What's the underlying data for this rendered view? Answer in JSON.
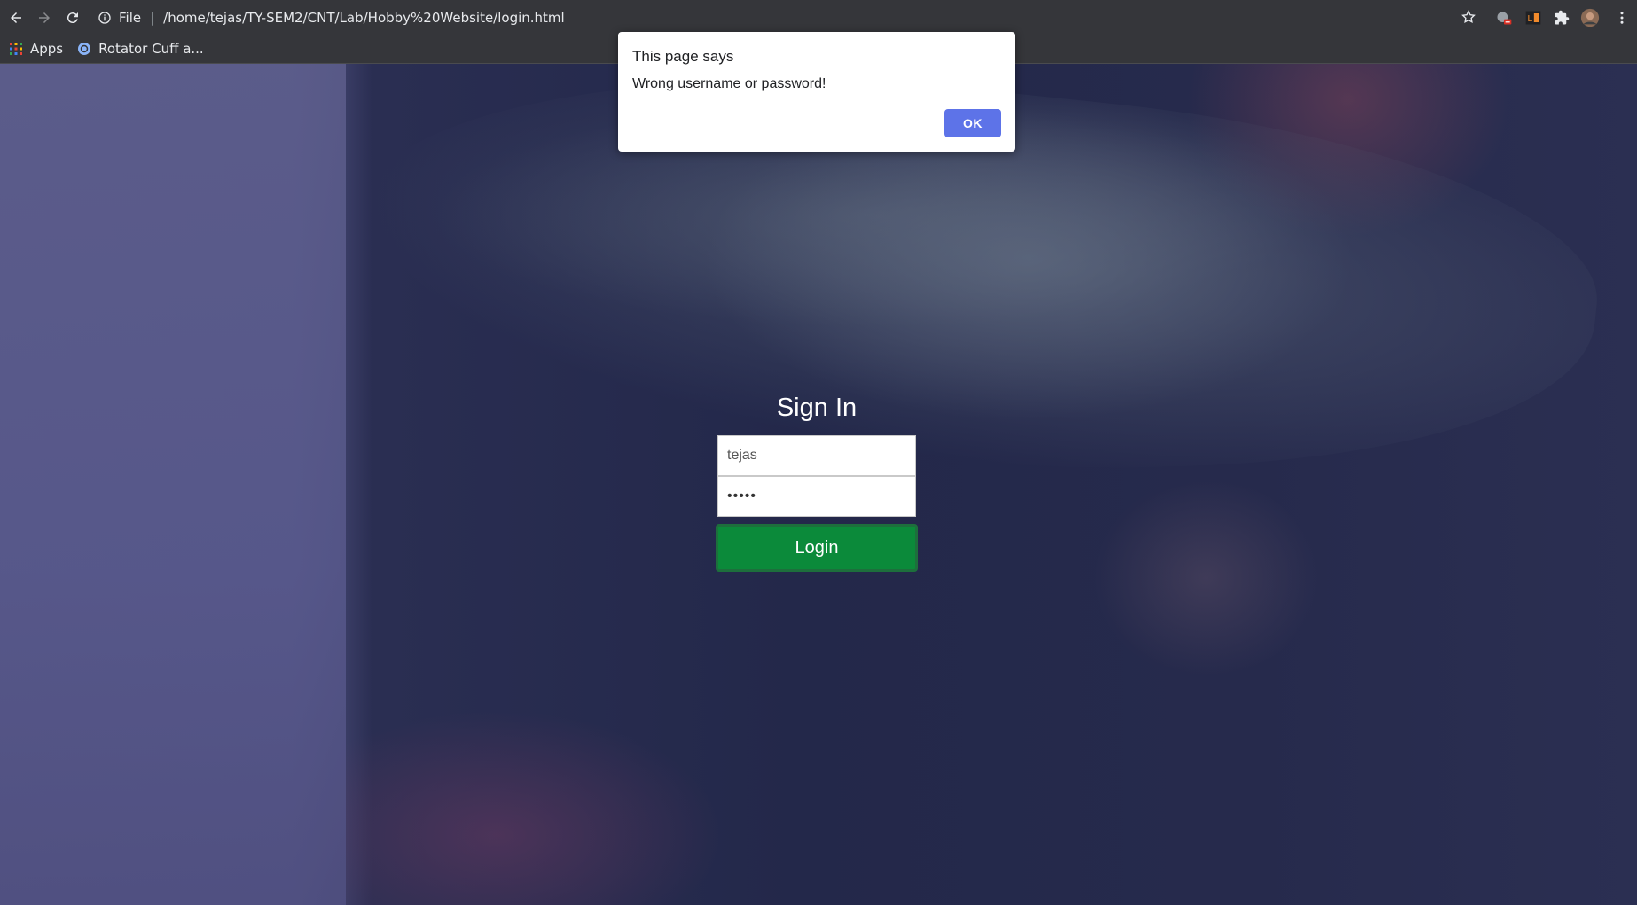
{
  "browser": {
    "scheme_label": "File",
    "url": "/home/tejas/TY-SEM2/CNT/Lab/Hobby%20Website/login.html",
    "icons": [
      "back-icon",
      "forward-icon",
      "reload-icon",
      "info-icon",
      "star-icon",
      "extension-icon",
      "puzzle-icon",
      "avatar",
      "menu-icon"
    ]
  },
  "bookmarks": {
    "items": [
      {
        "label": "Apps",
        "icon": "apps-grid-icon"
      },
      {
        "label": "Rotator Cuff a...",
        "icon": "bookmark-favicon"
      }
    ]
  },
  "login": {
    "title": "Sign In",
    "username_value": "tejas",
    "password_value": "•••••",
    "button_label": "Login"
  },
  "dialog": {
    "title": "This page says",
    "message": "Wrong username or password!",
    "ok_label": "OK"
  },
  "colors": {
    "login_button": "#0b8a3a",
    "dialog_ok": "#5d73e8",
    "chrome_bg": "#35363a"
  }
}
